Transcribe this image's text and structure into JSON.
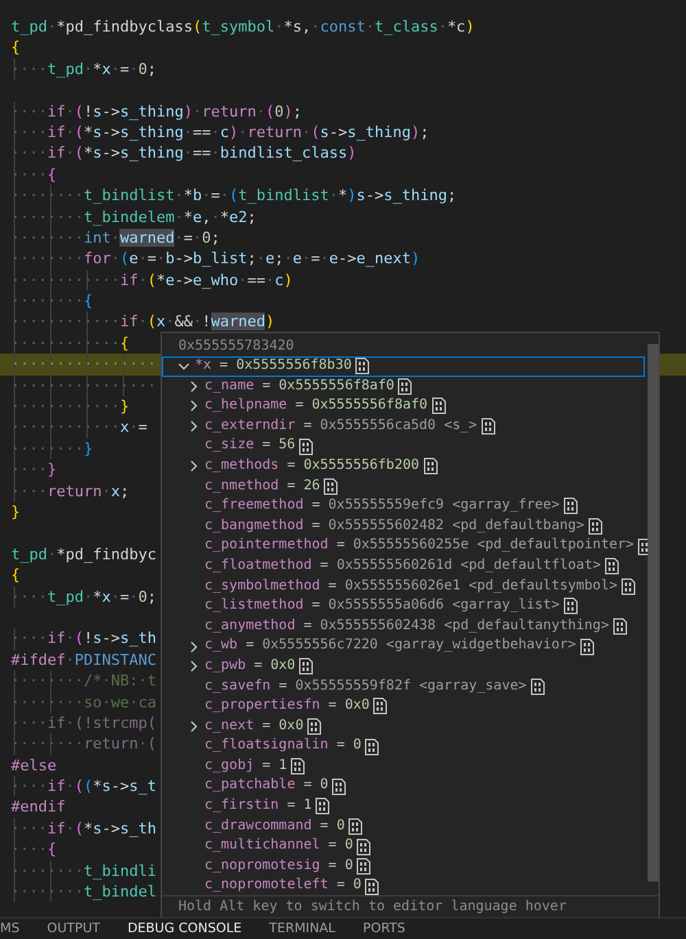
{
  "editor": {
    "lines": [
      {
        "current": false,
        "tokens": [
          {
            "kind": "type",
            "text": "t_pd"
          },
          {
            "kind": "plain",
            "text": "·*pd_findbyclass"
          },
          {
            "kind": "b1",
            "text": "("
          },
          {
            "kind": "type",
            "text": "t_symbol"
          },
          {
            "kind": "plain",
            "text": "·*s,·"
          },
          {
            "kind": "kw",
            "text": "const"
          },
          {
            "kind": "type",
            "text": "·t_class"
          },
          {
            "kind": "plain",
            "text": "·*c"
          },
          {
            "kind": "b1",
            "text": ")"
          }
        ]
      },
      {
        "current": false,
        "tokens": [
          {
            "kind": "b1",
            "text": "{"
          }
        ]
      },
      {
        "current": false,
        "tokens": [
          {
            "kind": "type",
            "text": "····t_pd"
          },
          {
            "kind": "plain",
            "text": "·*"
          },
          {
            "kind": "id",
            "text": "x"
          },
          {
            "kind": "plain",
            "text": "·=·"
          },
          {
            "kind": "num",
            "text": "0"
          },
          {
            "kind": "plain",
            "text": ";"
          }
        ]
      },
      {
        "current": false
      },
      {
        "current": false,
        "tokens": [
          {
            "kind": "ctrl",
            "text": "····if"
          },
          {
            "kind": "b2",
            "text": "·("
          },
          {
            "kind": "plain",
            "text": "!"
          },
          {
            "kind": "id",
            "text": "s"
          },
          {
            "kind": "plain",
            "text": "->"
          },
          {
            "kind": "id",
            "text": "s_thing"
          },
          {
            "kind": "b2",
            "text": ")"
          },
          {
            "kind": "ctrl",
            "text": "·return"
          },
          {
            "kind": "b2",
            "text": "·("
          },
          {
            "kind": "num",
            "text": "0"
          },
          {
            "kind": "b2",
            "text": ")"
          },
          {
            "kind": "plain",
            "text": ";"
          }
        ]
      },
      {
        "current": false,
        "tokens": [
          {
            "kind": "ctrl",
            "text": "····if"
          },
          {
            "kind": "b2",
            "text": "·("
          },
          {
            "kind": "plain",
            "text": "*"
          },
          {
            "kind": "id",
            "text": "s"
          },
          {
            "kind": "plain",
            "text": "->"
          },
          {
            "kind": "id",
            "text": "s_thing"
          },
          {
            "kind": "plain",
            "text": "·==·"
          },
          {
            "kind": "id",
            "text": "c"
          },
          {
            "kind": "b2",
            "text": ")"
          },
          {
            "kind": "ctrl",
            "text": "·return"
          },
          {
            "kind": "b2",
            "text": "·("
          },
          {
            "kind": "id",
            "text": "s"
          },
          {
            "kind": "plain",
            "text": "->"
          },
          {
            "kind": "id",
            "text": "s_thing"
          },
          {
            "kind": "b2",
            "text": ")"
          },
          {
            "kind": "plain",
            "text": ";"
          }
        ]
      },
      {
        "current": false,
        "tokens": [
          {
            "kind": "ctrl",
            "text": "····if"
          },
          {
            "kind": "b2",
            "text": "·("
          },
          {
            "kind": "plain",
            "text": "*"
          },
          {
            "kind": "id",
            "text": "s"
          },
          {
            "kind": "plain",
            "text": "->"
          },
          {
            "kind": "id",
            "text": "s_thing"
          },
          {
            "kind": "plain",
            "text": "·==·"
          },
          {
            "kind": "id",
            "text": "bindlist_class"
          },
          {
            "kind": "b2",
            "text": ")"
          }
        ]
      },
      {
        "current": false,
        "tokens": [
          {
            "kind": "b2",
            "text": "····{"
          }
        ]
      },
      {
        "current": false,
        "tokens": [
          {
            "kind": "type",
            "text": "········t_bindlist"
          },
          {
            "kind": "plain",
            "text": "·*"
          },
          {
            "kind": "id",
            "text": "b"
          },
          {
            "kind": "plain",
            "text": "·=·"
          },
          {
            "kind": "b3",
            "text": "("
          },
          {
            "kind": "type",
            "text": "t_bindlist"
          },
          {
            "kind": "plain",
            "text": "·*"
          },
          {
            "kind": "b3",
            "text": ")"
          },
          {
            "kind": "id",
            "text": "s"
          },
          {
            "kind": "plain",
            "text": "->"
          },
          {
            "kind": "id",
            "text": "s_thing"
          },
          {
            "kind": "plain",
            "text": ";"
          }
        ]
      },
      {
        "current": false,
        "tokens": [
          {
            "kind": "type",
            "text": "········t_bindelem"
          },
          {
            "kind": "plain",
            "text": "·*"
          },
          {
            "kind": "id",
            "text": "e"
          },
          {
            "kind": "plain",
            "text": ",·*"
          },
          {
            "kind": "id",
            "text": "e2"
          },
          {
            "kind": "plain",
            "text": ";"
          }
        ]
      },
      {
        "current": false,
        "tokens": [
          {
            "kind": "kw",
            "text": "········int·"
          },
          {
            "kind": "mark",
            "text": "warned"
          },
          {
            "kind": "plain",
            "text": "·=·"
          },
          {
            "kind": "num",
            "text": "0"
          },
          {
            "kind": "plain",
            "text": ";"
          }
        ]
      },
      {
        "current": false,
        "tokens": [
          {
            "kind": "ctrl",
            "text": "········for"
          },
          {
            "kind": "b3",
            "text": "·("
          },
          {
            "kind": "id",
            "text": "e"
          },
          {
            "kind": "plain",
            "text": "·=·"
          },
          {
            "kind": "id",
            "text": "b"
          },
          {
            "kind": "plain",
            "text": "->"
          },
          {
            "kind": "id",
            "text": "b_list"
          },
          {
            "kind": "plain",
            "text": ";·"
          },
          {
            "kind": "id",
            "text": "e"
          },
          {
            "kind": "plain",
            "text": ";·"
          },
          {
            "kind": "id",
            "text": "e"
          },
          {
            "kind": "plain",
            "text": "·=·"
          },
          {
            "kind": "id",
            "text": "e"
          },
          {
            "kind": "plain",
            "text": "->"
          },
          {
            "kind": "id",
            "text": "e_next"
          },
          {
            "kind": "b3",
            "text": ")"
          }
        ]
      },
      {
        "current": false,
        "tokens": [
          {
            "kind": "ctrl",
            "text": "············if"
          },
          {
            "kind": "b1",
            "text": "·("
          },
          {
            "kind": "plain",
            "text": "*"
          },
          {
            "kind": "id",
            "text": "e"
          },
          {
            "kind": "plain",
            "text": "->"
          },
          {
            "kind": "id",
            "text": "e_who"
          },
          {
            "kind": "plain",
            "text": "·==·"
          },
          {
            "kind": "id",
            "text": "c"
          },
          {
            "kind": "b1",
            "text": ")"
          }
        ]
      },
      {
        "current": false,
        "tokens": [
          {
            "kind": "b3",
            "text": "········{"
          }
        ]
      },
      {
        "current": false,
        "tokens": [
          {
            "kind": "ctrl",
            "text": "············if"
          },
          {
            "kind": "b1",
            "text": "·("
          },
          {
            "kind": "id",
            "text": "x"
          },
          {
            "kind": "plain",
            "text": "·&&·!"
          },
          {
            "kind": "mark",
            "text": "warned"
          },
          {
            "kind": "b1",
            "text": ")"
          }
        ]
      },
      {
        "current": false,
        "tokens": [
          {
            "kind": "b1",
            "text": "············{"
          }
        ]
      },
      {
        "current": true,
        "tokens": [
          {
            "kind": "plain",
            "text": "················"
          }
        ]
      },
      {
        "current": false,
        "tokens": [
          {
            "kind": "plain",
            "text": "················"
          }
        ]
      },
      {
        "current": false,
        "tokens": [
          {
            "kind": "b1",
            "text": "············}"
          }
        ]
      },
      {
        "current": false,
        "tokens": [
          {
            "kind": "id",
            "text": "············x"
          },
          {
            "kind": "plain",
            "text": "·="
          }
        ]
      },
      {
        "current": false,
        "tokens": [
          {
            "kind": "b3",
            "text": "········}"
          }
        ]
      },
      {
        "current": false,
        "tokens": [
          {
            "kind": "b2",
            "text": "····}"
          }
        ]
      },
      {
        "current": false,
        "tokens": [
          {
            "kind": "ctrl",
            "text": "····return"
          },
          {
            "kind": "id",
            "text": "·x"
          },
          {
            "kind": "plain",
            "text": ";"
          }
        ]
      },
      {
        "current": false,
        "tokens": [
          {
            "kind": "b1",
            "text": "}"
          }
        ]
      },
      {
        "current": false
      },
      {
        "current": false,
        "tokens": [
          {
            "kind": "type",
            "text": "t_pd"
          },
          {
            "kind": "plain",
            "text": "·*pd_findbyc"
          }
        ]
      },
      {
        "current": false,
        "tokens": [
          {
            "kind": "b1",
            "text": "{"
          }
        ]
      },
      {
        "current": false,
        "tokens": [
          {
            "kind": "type",
            "text": "····t_pd"
          },
          {
            "kind": "plain",
            "text": "·*"
          },
          {
            "kind": "id",
            "text": "x"
          },
          {
            "kind": "plain",
            "text": "·=·"
          },
          {
            "kind": "num",
            "text": "0"
          },
          {
            "kind": "plain",
            "text": ";"
          }
        ]
      },
      {
        "current": false
      },
      {
        "current": false,
        "tokens": [
          {
            "kind": "ctrl",
            "text": "····if"
          },
          {
            "kind": "b2",
            "text": "·("
          },
          {
            "kind": "plain",
            "text": "!"
          },
          {
            "kind": "id",
            "text": "s"
          },
          {
            "kind": "plain",
            "text": "->"
          },
          {
            "kind": "id",
            "text": "s_th"
          }
        ]
      },
      {
        "current": false,
        "tokens": [
          {
            "kind": "pre",
            "text": "#ifdef"
          },
          {
            "kind": "macro",
            "text": "·PDINSTANC"
          }
        ]
      },
      {
        "current": false,
        "tokens": [
          {
            "kind": "comment",
            "text": "········/*·NB:·t"
          }
        ]
      },
      {
        "current": false,
        "tokens": [
          {
            "kind": "comment",
            "text": "········so·we·ca"
          }
        ]
      },
      {
        "current": false,
        "tokens": [
          {
            "kind": "dim",
            "text": "····if·(!strcmp("
          }
        ]
      },
      {
        "current": false,
        "tokens": [
          {
            "kind": "dim",
            "text": "········return·("
          }
        ]
      },
      {
        "current": false,
        "tokens": [
          {
            "kind": "pre",
            "text": "#else"
          }
        ]
      },
      {
        "current": false,
        "tokens": [
          {
            "kind": "ctrl",
            "text": "····if"
          },
          {
            "kind": "b2",
            "text": "·("
          },
          {
            "kind": "b3",
            "text": "("
          },
          {
            "kind": "plain",
            "text": "*"
          },
          {
            "kind": "id",
            "text": "s"
          },
          {
            "kind": "plain",
            "text": "->"
          },
          {
            "kind": "id",
            "text": "s_t"
          }
        ]
      },
      {
        "current": false,
        "tokens": [
          {
            "kind": "pre",
            "text": "#endif"
          }
        ]
      },
      {
        "current": false,
        "tokens": [
          {
            "kind": "ctrl",
            "text": "····if"
          },
          {
            "kind": "b2",
            "text": "·("
          },
          {
            "kind": "plain",
            "text": "*"
          },
          {
            "kind": "id",
            "text": "s"
          },
          {
            "kind": "plain",
            "text": "->"
          },
          {
            "kind": "id",
            "text": "s_th"
          }
        ]
      },
      {
        "current": false,
        "tokens": [
          {
            "kind": "b2",
            "text": "····{"
          }
        ]
      },
      {
        "current": false,
        "tokens": [
          {
            "kind": "type",
            "text": "········t_bindli"
          }
        ]
      },
      {
        "current": false,
        "tokens": [
          {
            "kind": "type",
            "text": "········t_bindel"
          }
        ]
      }
    ]
  },
  "hover": {
    "header": "0x555555783420",
    "root": {
      "name": "*x",
      "operator": "=",
      "value": "0x5555556f8b30",
      "expanded": true,
      "selected": true,
      "children": [
        {
          "name": "c_name",
          "operator": "=",
          "value": "0x5555556f8af0",
          "expandable": true
        },
        {
          "name": "c_helpname",
          "operator": "=",
          "value": "0x5555556f8af0",
          "expandable": true
        },
        {
          "name": "c_externdir",
          "operator": "=",
          "value": "0x5555556ca5d0",
          "symbol": "<s_>",
          "expandable": true
        },
        {
          "name": "c_size",
          "operator": "=",
          "value": "56",
          "expandable": false
        },
        {
          "name": "c_methods",
          "operator": "=",
          "value": "0x5555556fb200",
          "expandable": true
        },
        {
          "name": "c_nmethod",
          "operator": "=",
          "value": "26",
          "expandable": false
        },
        {
          "name": "c_freemethod",
          "operator": "=",
          "value": "0x55555559efc9",
          "symbol": "<garray_free>",
          "expandable": false
        },
        {
          "name": "c_bangmethod",
          "operator": "=",
          "value": "0x555555602482",
          "symbol": "<pd_defaultbang>",
          "expandable": false
        },
        {
          "name": "c_pointermethod",
          "operator": "=",
          "value": "0x55555560255e",
          "symbol": "<pd_defaultpointer>",
          "expandable": false
        },
        {
          "name": "c_floatmethod",
          "operator": "=",
          "value": "0x55555560261d",
          "symbol": "<pd_defaultfloat>",
          "expandable": false
        },
        {
          "name": "c_symbolmethod",
          "operator": "=",
          "value": "0x5555556026e1",
          "symbol": "<pd_defaultsymbol>",
          "expandable": false
        },
        {
          "name": "c_listmethod",
          "operator": "=",
          "value": "0x5555555a06d6",
          "symbol": "<garray_list>",
          "expandable": false
        },
        {
          "name": "c_anymethod",
          "operator": "=",
          "value": "0x555555602438",
          "symbol": "<pd_defaultanything>",
          "expandable": false
        },
        {
          "name": "c_wb",
          "operator": "=",
          "value": "0x5555556c7220",
          "symbol": "<garray_widgetbehavior>",
          "expandable": true
        },
        {
          "name": "c_pwb",
          "operator": "=",
          "value": "0x0",
          "expandable": true
        },
        {
          "name": "c_savefn",
          "operator": "=",
          "value": "0x55555559f82f",
          "symbol": "<garray_save>",
          "expandable": false
        },
        {
          "name": "c_propertiesfn",
          "operator": "=",
          "value": "0x0",
          "expandable": false
        },
        {
          "name": "c_next",
          "operator": "=",
          "value": "0x0",
          "expandable": true
        },
        {
          "name": "c_floatsignalin",
          "operator": "=",
          "value": "0",
          "expandable": false
        },
        {
          "name": "c_gobj",
          "operator": "=",
          "value": "1",
          "expandable": false
        },
        {
          "name": "c_patchable",
          "operator": "=",
          "value": "0",
          "expandable": false
        },
        {
          "name": "c_firstin",
          "operator": "=",
          "value": "1",
          "expandable": false
        },
        {
          "name": "c_drawcommand",
          "operator": "=",
          "value": "0",
          "expandable": false
        },
        {
          "name": "c_multichannel",
          "operator": "=",
          "value": "0",
          "expandable": false
        },
        {
          "name": "c_nopromotesig",
          "operator": "=",
          "value": "0",
          "expandable": false
        },
        {
          "name": "c_nopromoteleft",
          "operator": "=",
          "value": "0",
          "expandable": false
        }
      ]
    },
    "hint": "Hold Alt key to switch to editor language hover"
  },
  "panel_tabs": [
    {
      "label": "MS",
      "selected": false
    },
    {
      "label": "OUTPUT",
      "selected": false
    },
    {
      "label": "DEBUG CONSOLE",
      "selected": true
    },
    {
      "label": "TERMINAL",
      "selected": false
    },
    {
      "label": "PORTS",
      "selected": false
    }
  ]
}
